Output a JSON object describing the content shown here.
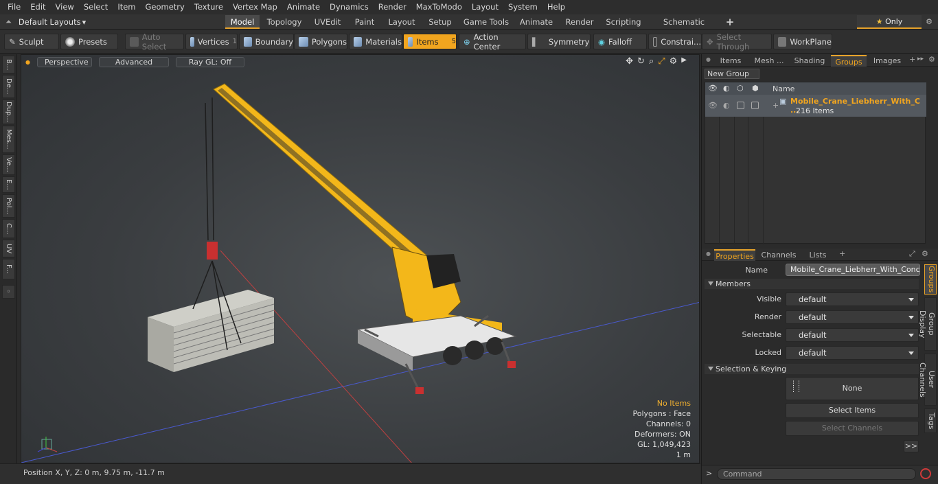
{
  "menu": [
    "File",
    "Edit",
    "View",
    "Select",
    "Item",
    "Geometry",
    "Texture",
    "Vertex Map",
    "Animate",
    "Dynamics",
    "Render",
    "MaxToModo",
    "Layout",
    "System",
    "Help"
  ],
  "layouts_label": "Default Layouts",
  "tabs": [
    "Model",
    "Topology",
    "UVEdit",
    "Paint",
    "Layout",
    "Setup",
    "Game Tools",
    "Animate",
    "Render",
    "Scripting",
    "Schematic Fusion"
  ],
  "add_tab": "+",
  "only_label": "Only",
  "toolbar": {
    "sculpt": "Sculpt",
    "presets": "Presets",
    "auto_select": "Auto Select",
    "vertices": "Vertices",
    "vertices_count": "1",
    "boundary": "Boundary",
    "polygons": "Polygons",
    "materials": "Materials",
    "items": "Items",
    "items_count": "5",
    "action_center": "Action Center",
    "symmetry": "Symmetry",
    "falloff": "Falloff",
    "constraints": "Constrai...",
    "select_through": "Select Through",
    "workplane": "WorkPlane"
  },
  "left_tabs": [
    "B...",
    "De...",
    "Dup...",
    "Mes...",
    "Ve...",
    "E...",
    "Pol...",
    "C...",
    "UV",
    "F..."
  ],
  "viewport": {
    "perspective": "Perspective",
    "advanced": "Advanced",
    "raygl": "Ray GL: Off",
    "stats": {
      "items": "No Items",
      "polygons": "Polygons : Face",
      "channels": "Channels: 0",
      "deformers": "Deformers: ON",
      "gl": "GL: 1,049,423",
      "scale": "1 m"
    }
  },
  "status": {
    "position": "Position X, Y, Z:   0 m, 9.75 m, -11.7 m"
  },
  "panel_top": {
    "tabs": [
      "Items",
      "Mesh ...",
      "Shading",
      "Groups",
      "Images"
    ],
    "active": "Groups",
    "new_group": "New Group",
    "col_name": "Name",
    "group_name": "Mobile_Crane_Liebherr_With_C ...",
    "group_count": "216 Items"
  },
  "panel_bottom": {
    "tabs": [
      "Properties",
      "Channels",
      "Lists"
    ],
    "name_label": "Name",
    "name_value": "Mobile_Crane_Liebherr_With_Concret",
    "members": "Members",
    "visible_label": "Visible",
    "visible": "default",
    "render_label": "Render",
    "render": "default",
    "selectable_label": "Selectable",
    "selectable": "default",
    "locked_label": "Locked",
    "locked": "default",
    "sel_keying": "Selection & Keying",
    "none": "None",
    "select_items": "Select Items",
    "select_channels": "Select Channels",
    "more": ">>",
    "side_tabs": [
      "Groups",
      "Group Display",
      "User Channels",
      "Tags"
    ]
  },
  "command_placeholder": "Command",
  "colors": {
    "accent": "#f1a51f",
    "crane": "#f3b71a"
  }
}
